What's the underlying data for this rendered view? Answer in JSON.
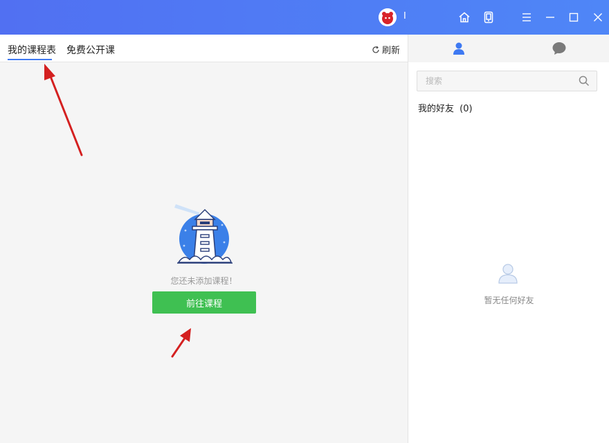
{
  "titlebar": {
    "username": "I",
    "icons": [
      "home-icon",
      "phone-icon",
      "menu-icon",
      "minimize-icon",
      "maximize-icon",
      "close-icon"
    ]
  },
  "tabs": [
    {
      "label": "我的课程表",
      "active": true
    },
    {
      "label": "免费公开课",
      "active": false
    }
  ],
  "refresh_label": "刷新",
  "main": {
    "empty_text": "您还未添加课程！",
    "go_button": "前往课程"
  },
  "sidebar": {
    "tabs": [
      "contacts-icon",
      "chat-icon"
    ],
    "search_placeholder": "搜索",
    "friends_label": "我的好友",
    "friends_count": "(0)",
    "no_friends_text": "暂无任何好友"
  },
  "colors": {
    "titlebar": "#4f7ef5",
    "accent": "#3e79f2",
    "button": "#3fc052",
    "annotation": "#d42020"
  }
}
